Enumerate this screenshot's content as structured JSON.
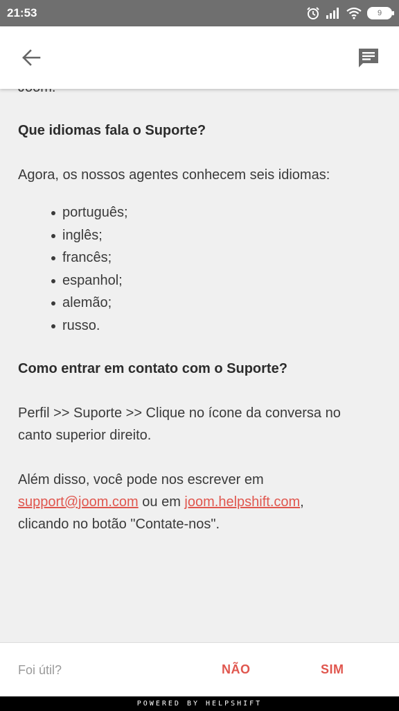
{
  "status_bar": {
    "time": "21:53",
    "battery": "9",
    "icons": [
      "alarm-icon",
      "signal-icon",
      "wifi-icon",
      "battery-icon"
    ]
  },
  "app_bar": {
    "back_icon": "arrow-left-icon",
    "chat_icon": "chat-bubble-icon"
  },
  "article": {
    "cut_line": "Joom.",
    "q1_heading": "Que idiomas fala o Suporte?",
    "q1_intro": "Agora, os nossos agentes conhecem seis idiomas:",
    "languages": [
      "português;",
      "inglês;",
      "francês;",
      "espanhol;",
      "alemão;",
      "russo."
    ],
    "q2_heading": "Como entrar em contato com o Suporte?",
    "q2_path": "Perfil >> Suporte >> Clique no ícone da conversa no canto superior direito.",
    "q2_also_prefix": "Além disso, você pode nos escrever em",
    "email_link": "support@joom.com",
    "or_text": "ou em",
    "helpshift_link": "joom.helpshift.com",
    "comma": ",",
    "q2_also_suffix": "clicando no botão \"Contate-nos\"."
  },
  "footer": {
    "helpful_label": "Foi útil?",
    "no_label": "NÃO",
    "yes_label": "SIM",
    "powered_by": "POWERED BY HELPSHIFT"
  },
  "colors": {
    "accent": "#e0564e",
    "status_bar": "#6f6f6f",
    "background": "#f0f0f0"
  }
}
